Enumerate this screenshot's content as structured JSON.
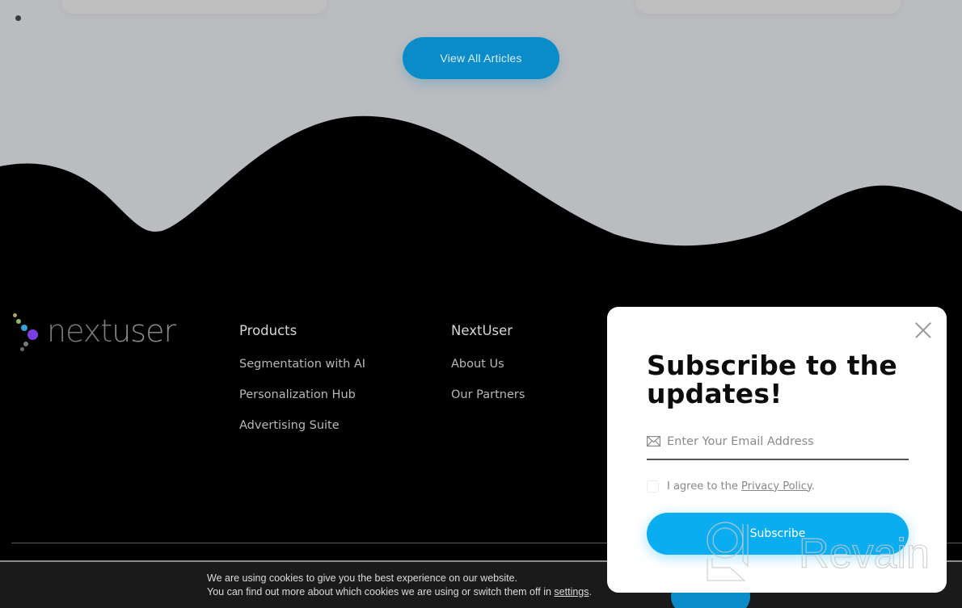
{
  "page": {
    "view_all_label": "View All Articles"
  },
  "footer": {
    "logo": {
      "text_a": "next",
      "text_b": "user",
      "dot_colors": [
        "#b3a26a",
        "#8fb36a",
        "#3aa0d8",
        "#7a3fe0",
        "#7a7a7a",
        "#6a6a6a"
      ]
    },
    "columns": [
      {
        "heading": "Products",
        "links": [
          "Segmentation with AI",
          "Personalization Hub",
          "Advertising Suite"
        ]
      },
      {
        "heading": "NextUser",
        "links": [
          "About Us",
          "Our Partners"
        ]
      }
    ]
  },
  "cookie_bar": {
    "line1": "We are using cookies to give you the best experience on our website.",
    "line2_prefix": "You can find out more about which cookies we are using or switch them off in ",
    "settings_link": "settings",
    "line2_suffix": "."
  },
  "modal": {
    "title": "Subscribe to the updates!",
    "email_placeholder": "Enter Your Email Address",
    "email_value": "",
    "agree_prefix": "I agree to the ",
    "privacy_link": "Privacy Policy",
    "agree_suffix": ".",
    "agree_checked": false,
    "subscribe_label": "Subscribe",
    "close_icon": "close-icon",
    "email_icon": "envelope-icon"
  },
  "watermark": {
    "text": "Revain"
  },
  "colors": {
    "accent": "#0aaef0",
    "button_dim": "#0a8cc8",
    "overlay_bg": "#bbbcbf",
    "footer_bg": "#000000",
    "cookie_bg": "#1a1a1a"
  }
}
